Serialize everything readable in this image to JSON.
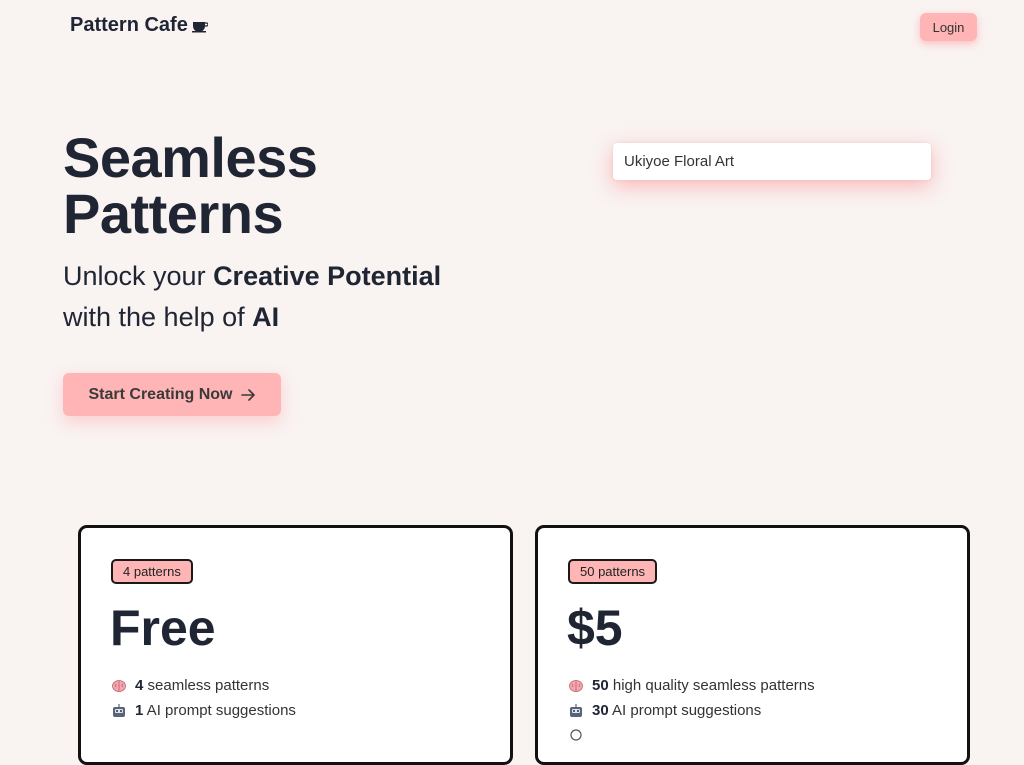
{
  "header": {
    "brand": "Pattern Cafe",
    "brand_icon": "coffee-cup-icon",
    "login_label": "Login"
  },
  "hero": {
    "title_line1": "Seamless",
    "title_line2": "Patterns",
    "sub_pre1": "Unlock your ",
    "sub_bold1": "Creative Potential",
    "sub_pre2": "with the help of ",
    "sub_bold2": "AI",
    "cta_label": "Start Creating Now",
    "cta_icon": "arrow-right-icon"
  },
  "search": {
    "value": "Ukiyoe Floral Art"
  },
  "plans": [
    {
      "badge": "4 patterns",
      "price": "Free",
      "features": [
        {
          "icon": "brain-icon",
          "bold": "4",
          "text": " seamless patterns"
        },
        {
          "icon": "robot-icon",
          "bold": "1",
          "text": " AI prompt suggestions"
        }
      ]
    },
    {
      "badge": "50 patterns",
      "price": "$5",
      "features": [
        {
          "icon": "brain-icon",
          "bold": "50",
          "text": " high quality seamless patterns"
        },
        {
          "icon": "robot-icon",
          "bold": "30",
          "text": " AI prompt suggestions"
        },
        {
          "icon": "sparkle-icon",
          "bold": "",
          "text": ""
        }
      ]
    }
  ],
  "colors": {
    "background": "#f9f3f2",
    "accent": "#ffb5b5",
    "text": "#1f2533"
  }
}
